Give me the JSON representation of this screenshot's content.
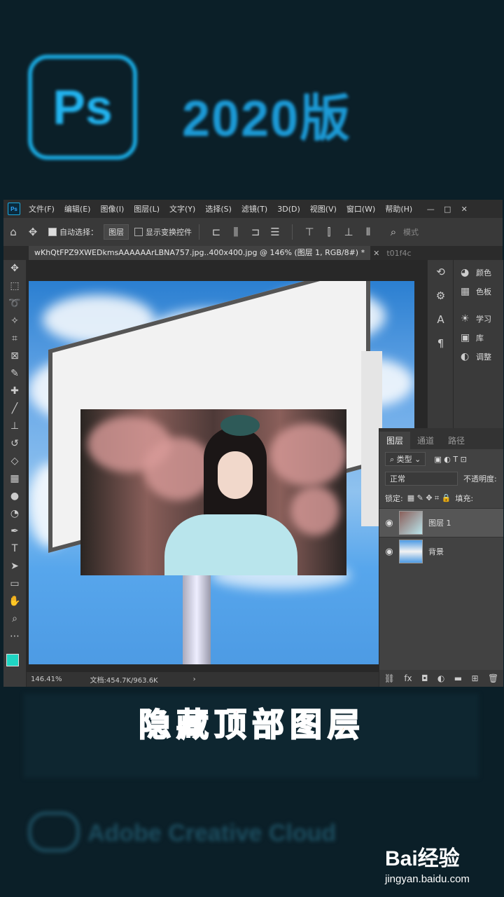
{
  "splash": {
    "logo_text": "Ps",
    "title": "2020版",
    "cc_text": "Adobe Creative Cloud"
  },
  "menubar": {
    "app_icon": "Ps",
    "items": [
      "文件(F)",
      "编辑(E)",
      "图像(I)",
      "图层(L)",
      "文字(Y)",
      "选择(S)",
      "滤镜(T)",
      "3D(D)",
      "视图(V)",
      "窗口(W)",
      "帮助(H)"
    ]
  },
  "options": {
    "auto_select_label": "自动选择：",
    "auto_select_value": "图层",
    "show_transform_label": "显示变换控件",
    "mode_label": "模式"
  },
  "tabs": {
    "active": "wKhQtFPZ9XWEDkmsAAAAAArLBNA757.jpg..400x400.jpg @ 146% (图层 1, RGB/8#) *",
    "next": "t01f4c"
  },
  "status": {
    "zoom": "146.41%",
    "doc": "文档:454.7K/963.6K"
  },
  "panels": {
    "colors": "颜色",
    "swatches": "色板",
    "learn": "学习",
    "libraries": "库",
    "adjust": "调整"
  },
  "layers_panel": {
    "tabs": [
      "图层",
      "通道",
      "路径"
    ],
    "kind": "类型",
    "blend": "正常",
    "opacity_label": "不透明度:",
    "lock_label": "锁定:",
    "fill_label": "填充:",
    "layers": [
      "图层 1",
      "背景"
    ]
  },
  "caption": {
    "chars": [
      "隐",
      "藏",
      "顶",
      "部",
      "图",
      "层"
    ],
    "colors": [
      "#7a32ff",
      "#d81fb4",
      "#ff3b7a",
      "#ff5a3c",
      "#ff7d25",
      "#ffa21c"
    ]
  },
  "watermark": {
    "brand": "Bai经验",
    "url": "jingyan.baidu.com"
  }
}
